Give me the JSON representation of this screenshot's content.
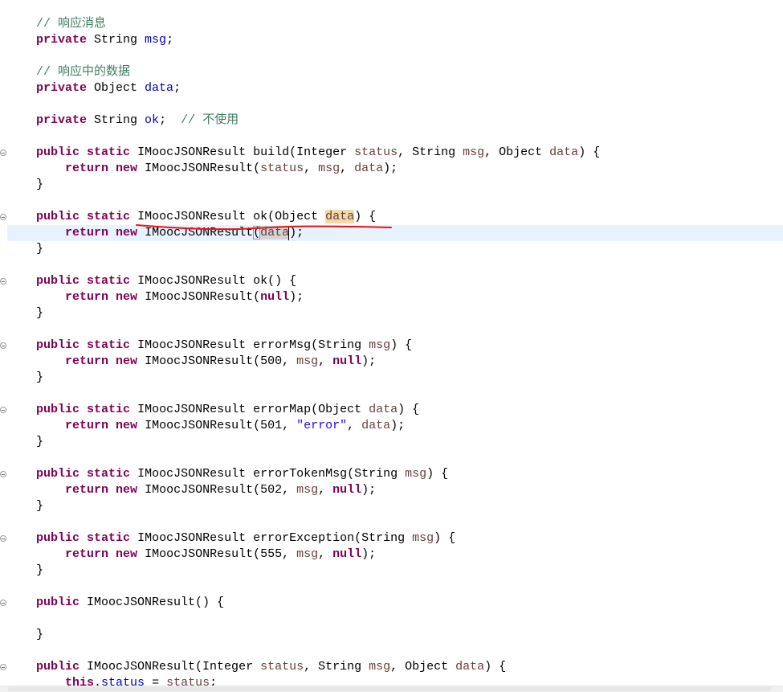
{
  "colors": {
    "keyword": "#7F0055",
    "comment": "#3F7F5F",
    "field": "#0000C0",
    "parameter": "#6A3E3E",
    "string": "#2A00FF",
    "current_line": "#E8F2FE",
    "occurrence_write": "#F3D9AA",
    "occurrence_read": "#D4D4D4",
    "bracket_match": "#9A9A9A",
    "annotation": "#E8141A"
  },
  "editor": {
    "current_line": 13,
    "lines": [
      {
        "tokens": [
          {
            "k": "plain",
            "t": "    "
          },
          {
            "k": "comment",
            "t": "// 响应消息"
          }
        ]
      },
      {
        "tokens": [
          {
            "k": "plain",
            "t": "    "
          },
          {
            "k": "keyword",
            "t": "private"
          },
          {
            "k": "plain",
            "t": " String "
          },
          {
            "k": "field",
            "t": "msg"
          },
          {
            "k": "plain",
            "t": ";"
          }
        ]
      },
      {
        "tokens": []
      },
      {
        "tokens": [
          {
            "k": "plain",
            "t": "    "
          },
          {
            "k": "comment",
            "t": "// 响应中的数据"
          }
        ]
      },
      {
        "tokens": [
          {
            "k": "plain",
            "t": "    "
          },
          {
            "k": "keyword",
            "t": "private"
          },
          {
            "k": "plain",
            "t": " Object "
          },
          {
            "k": "field",
            "t": "data"
          },
          {
            "k": "plain",
            "t": ";"
          }
        ]
      },
      {
        "tokens": []
      },
      {
        "tokens": [
          {
            "k": "plain",
            "t": "    "
          },
          {
            "k": "keyword",
            "t": "private"
          },
          {
            "k": "plain",
            "t": " String "
          },
          {
            "k": "field",
            "t": "ok"
          },
          {
            "k": "plain",
            "t": ";  "
          },
          {
            "k": "comment",
            "t": "// 不使用"
          }
        ]
      },
      {
        "tokens": []
      },
      {
        "fold": true,
        "tokens": [
          {
            "k": "plain",
            "t": "    "
          },
          {
            "k": "keyword",
            "t": "public"
          },
          {
            "k": "plain",
            "t": " "
          },
          {
            "k": "keyword",
            "t": "static"
          },
          {
            "k": "plain",
            "t": " IMoocJSONResult build(Integer "
          },
          {
            "k": "parameter",
            "t": "status"
          },
          {
            "k": "plain",
            "t": ", String "
          },
          {
            "k": "parameter",
            "t": "msg"
          },
          {
            "k": "plain",
            "t": ", Object "
          },
          {
            "k": "parameter",
            "t": "data"
          },
          {
            "k": "plain",
            "t": ") {"
          }
        ]
      },
      {
        "tokens": [
          {
            "k": "plain",
            "t": "        "
          },
          {
            "k": "keyword",
            "t": "return"
          },
          {
            "k": "plain",
            "t": " "
          },
          {
            "k": "keyword",
            "t": "new"
          },
          {
            "k": "plain",
            "t": " IMoocJSONResult("
          },
          {
            "k": "parameter",
            "t": "status"
          },
          {
            "k": "plain",
            "t": ", "
          },
          {
            "k": "parameter",
            "t": "msg"
          },
          {
            "k": "plain",
            "t": ", "
          },
          {
            "k": "parameter",
            "t": "data"
          },
          {
            "k": "plain",
            "t": ");"
          }
        ]
      },
      {
        "tokens": [
          {
            "k": "plain",
            "t": "    }"
          }
        ]
      },
      {
        "tokens": []
      },
      {
        "fold": true,
        "tokens": [
          {
            "k": "plain",
            "t": "    "
          },
          {
            "k": "keyword",
            "t": "public"
          },
          {
            "k": "plain",
            "t": " "
          },
          {
            "k": "keyword",
            "t": "static"
          },
          {
            "k": "plain",
            "t": " IMoocJSONResult ok(Object "
          },
          {
            "k": "parameter",
            "t": "data",
            "mark": "occurrence-write"
          },
          {
            "k": "plain",
            "t": ") {"
          }
        ]
      },
      {
        "tokens": [
          {
            "k": "plain",
            "t": "        "
          },
          {
            "k": "keyword",
            "t": "return"
          },
          {
            "k": "plain",
            "t": " "
          },
          {
            "k": "keyword",
            "t": "new"
          },
          {
            "k": "plain",
            "t": " IMoocJSONResult"
          },
          {
            "k": "plain",
            "t": "(",
            "mark": "bracket-match"
          },
          {
            "k": "parameter",
            "t": "data",
            "mark": "occurrence-read",
            "caret": true
          },
          {
            "k": "plain",
            "t": ");"
          }
        ]
      },
      {
        "tokens": [
          {
            "k": "plain",
            "t": "    }"
          }
        ]
      },
      {
        "tokens": []
      },
      {
        "fold": true,
        "tokens": [
          {
            "k": "plain",
            "t": "    "
          },
          {
            "k": "keyword",
            "t": "public"
          },
          {
            "k": "plain",
            "t": " "
          },
          {
            "k": "keyword",
            "t": "static"
          },
          {
            "k": "plain",
            "t": " IMoocJSONResult ok() {"
          }
        ]
      },
      {
        "tokens": [
          {
            "k": "plain",
            "t": "        "
          },
          {
            "k": "keyword",
            "t": "return"
          },
          {
            "k": "plain",
            "t": " "
          },
          {
            "k": "keyword",
            "t": "new"
          },
          {
            "k": "plain",
            "t": " IMoocJSONResult("
          },
          {
            "k": "keyword",
            "t": "null"
          },
          {
            "k": "plain",
            "t": ");"
          }
        ]
      },
      {
        "tokens": [
          {
            "k": "plain",
            "t": "    }"
          }
        ]
      },
      {
        "tokens": []
      },
      {
        "fold": true,
        "tokens": [
          {
            "k": "plain",
            "t": "    "
          },
          {
            "k": "keyword",
            "t": "public"
          },
          {
            "k": "plain",
            "t": " "
          },
          {
            "k": "keyword",
            "t": "static"
          },
          {
            "k": "plain",
            "t": " IMoocJSONResult errorMsg(String "
          },
          {
            "k": "parameter",
            "t": "msg"
          },
          {
            "k": "plain",
            "t": ") {"
          }
        ]
      },
      {
        "tokens": [
          {
            "k": "plain",
            "t": "        "
          },
          {
            "k": "keyword",
            "t": "return"
          },
          {
            "k": "plain",
            "t": " "
          },
          {
            "k": "keyword",
            "t": "new"
          },
          {
            "k": "plain",
            "t": " IMoocJSONResult(500, "
          },
          {
            "k": "parameter",
            "t": "msg"
          },
          {
            "k": "plain",
            "t": ", "
          },
          {
            "k": "keyword",
            "t": "null"
          },
          {
            "k": "plain",
            "t": ");"
          }
        ]
      },
      {
        "tokens": [
          {
            "k": "plain",
            "t": "    }"
          }
        ]
      },
      {
        "tokens": []
      },
      {
        "fold": true,
        "tokens": [
          {
            "k": "plain",
            "t": "    "
          },
          {
            "k": "keyword",
            "t": "public"
          },
          {
            "k": "plain",
            "t": " "
          },
          {
            "k": "keyword",
            "t": "static"
          },
          {
            "k": "plain",
            "t": " IMoocJSONResult errorMap(Object "
          },
          {
            "k": "parameter",
            "t": "data"
          },
          {
            "k": "plain",
            "t": ") {"
          }
        ]
      },
      {
        "tokens": [
          {
            "k": "plain",
            "t": "        "
          },
          {
            "k": "keyword",
            "t": "return"
          },
          {
            "k": "plain",
            "t": " "
          },
          {
            "k": "keyword",
            "t": "new"
          },
          {
            "k": "plain",
            "t": " IMoocJSONResult(501, "
          },
          {
            "k": "string",
            "t": "\"error\""
          },
          {
            "k": "plain",
            "t": ", "
          },
          {
            "k": "parameter",
            "t": "data"
          },
          {
            "k": "plain",
            "t": ");"
          }
        ]
      },
      {
        "tokens": [
          {
            "k": "plain",
            "t": "    }"
          }
        ]
      },
      {
        "tokens": []
      },
      {
        "fold": true,
        "tokens": [
          {
            "k": "plain",
            "t": "    "
          },
          {
            "k": "keyword",
            "t": "public"
          },
          {
            "k": "plain",
            "t": " "
          },
          {
            "k": "keyword",
            "t": "static"
          },
          {
            "k": "plain",
            "t": " IMoocJSONResult errorTokenMsg(String "
          },
          {
            "k": "parameter",
            "t": "msg"
          },
          {
            "k": "plain",
            "t": ") {"
          }
        ]
      },
      {
        "tokens": [
          {
            "k": "plain",
            "t": "        "
          },
          {
            "k": "keyword",
            "t": "return"
          },
          {
            "k": "plain",
            "t": " "
          },
          {
            "k": "keyword",
            "t": "new"
          },
          {
            "k": "plain",
            "t": " IMoocJSONResult(502, "
          },
          {
            "k": "parameter",
            "t": "msg"
          },
          {
            "k": "plain",
            "t": ", "
          },
          {
            "k": "keyword",
            "t": "null"
          },
          {
            "k": "plain",
            "t": ");"
          }
        ]
      },
      {
        "tokens": [
          {
            "k": "plain",
            "t": "    }"
          }
        ]
      },
      {
        "tokens": []
      },
      {
        "fold": true,
        "tokens": [
          {
            "k": "plain",
            "t": "    "
          },
          {
            "k": "keyword",
            "t": "public"
          },
          {
            "k": "plain",
            "t": " "
          },
          {
            "k": "keyword",
            "t": "static"
          },
          {
            "k": "plain",
            "t": " IMoocJSONResult errorException(String "
          },
          {
            "k": "parameter",
            "t": "msg"
          },
          {
            "k": "plain",
            "t": ") {"
          }
        ]
      },
      {
        "tokens": [
          {
            "k": "plain",
            "t": "        "
          },
          {
            "k": "keyword",
            "t": "return"
          },
          {
            "k": "plain",
            "t": " "
          },
          {
            "k": "keyword",
            "t": "new"
          },
          {
            "k": "plain",
            "t": " IMoocJSONResult(555, "
          },
          {
            "k": "parameter",
            "t": "msg"
          },
          {
            "k": "plain",
            "t": ", "
          },
          {
            "k": "keyword",
            "t": "null"
          },
          {
            "k": "plain",
            "t": ");"
          }
        ]
      },
      {
        "tokens": [
          {
            "k": "plain",
            "t": "    }"
          }
        ]
      },
      {
        "tokens": []
      },
      {
        "fold": true,
        "tokens": [
          {
            "k": "plain",
            "t": "    "
          },
          {
            "k": "keyword",
            "t": "public"
          },
          {
            "k": "plain",
            "t": " IMoocJSONResult() {"
          }
        ]
      },
      {
        "tokens": []
      },
      {
        "tokens": [
          {
            "k": "plain",
            "t": "    }"
          }
        ]
      },
      {
        "tokens": []
      },
      {
        "fold": true,
        "tokens": [
          {
            "k": "plain",
            "t": "    "
          },
          {
            "k": "keyword",
            "t": "public"
          },
          {
            "k": "plain",
            "t": " IMoocJSONResult(Integer "
          },
          {
            "k": "parameter",
            "t": "status"
          },
          {
            "k": "plain",
            "t": ", String "
          },
          {
            "k": "parameter",
            "t": "msg"
          },
          {
            "k": "plain",
            "t": ", Object "
          },
          {
            "k": "parameter",
            "t": "data"
          },
          {
            "k": "plain",
            "t": ") {"
          }
        ]
      },
      {
        "tokens": [
          {
            "k": "plain",
            "t": "        "
          },
          {
            "k": "keyword",
            "t": "this"
          },
          {
            "k": "plain",
            "t": "."
          },
          {
            "k": "field",
            "t": "status"
          },
          {
            "k": "plain",
            "t": " = "
          },
          {
            "k": "parameter",
            "t": "status"
          },
          {
            "k": "plain",
            "t": ";"
          }
        ]
      }
    ]
  }
}
